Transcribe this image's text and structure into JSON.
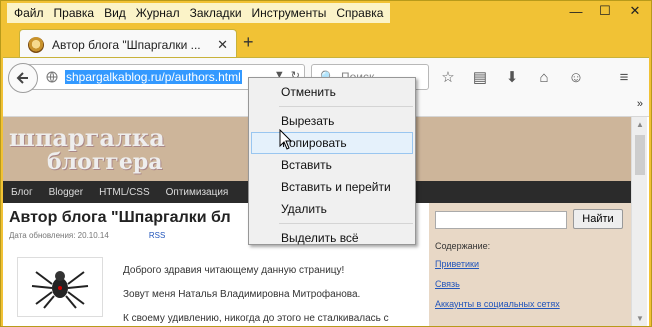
{
  "menubar": {
    "items": [
      "Файл",
      "Правка",
      "Вид",
      "Журнал",
      "Закладки",
      "Инструменты",
      "Справка"
    ]
  },
  "window": {
    "min": "—",
    "max": "☐",
    "close": "✕"
  },
  "tab": {
    "title": "Автор блога \"Шпаргалки ...",
    "close": "✕",
    "new_tab": "+"
  },
  "navbar": {
    "url": "shpargalkablog.ru/p/authors.html",
    "search_placeholder": "Поиск",
    "back_icon": "back-arrow-icon"
  },
  "bookmarks": {
    "more": "»"
  },
  "page": {
    "logo_line1": "шпаргалка",
    "logo_line2": "блоггера",
    "nav": [
      "Блог",
      "Blogger",
      "HTML/CSS",
      "Оптимизация"
    ],
    "article_title": "Автор блога \"Шпаргалки бл",
    "meta_date": "Дата обновления: 20.10.14",
    "meta_rss": "RSS",
    "para1": "Доброго здравия читающему данную страницу!",
    "para2": "Зовут меня Наталья Владимировна Митрофанова.",
    "para3": "К своему удивлению, никогда до этого не сталкивалась с",
    "sidebar": {
      "find_button": "Найти",
      "label": "Содержание:",
      "links": [
        "Приветики",
        "Связь",
        "Аккаунты в социальных сетях"
      ]
    }
  },
  "context_menu": {
    "items": [
      "Отменить",
      "Вырезать",
      "Копировать",
      "Вставить",
      "Вставить и перейти",
      "Удалить",
      "Выделить всё"
    ],
    "highlighted": "Копировать"
  }
}
